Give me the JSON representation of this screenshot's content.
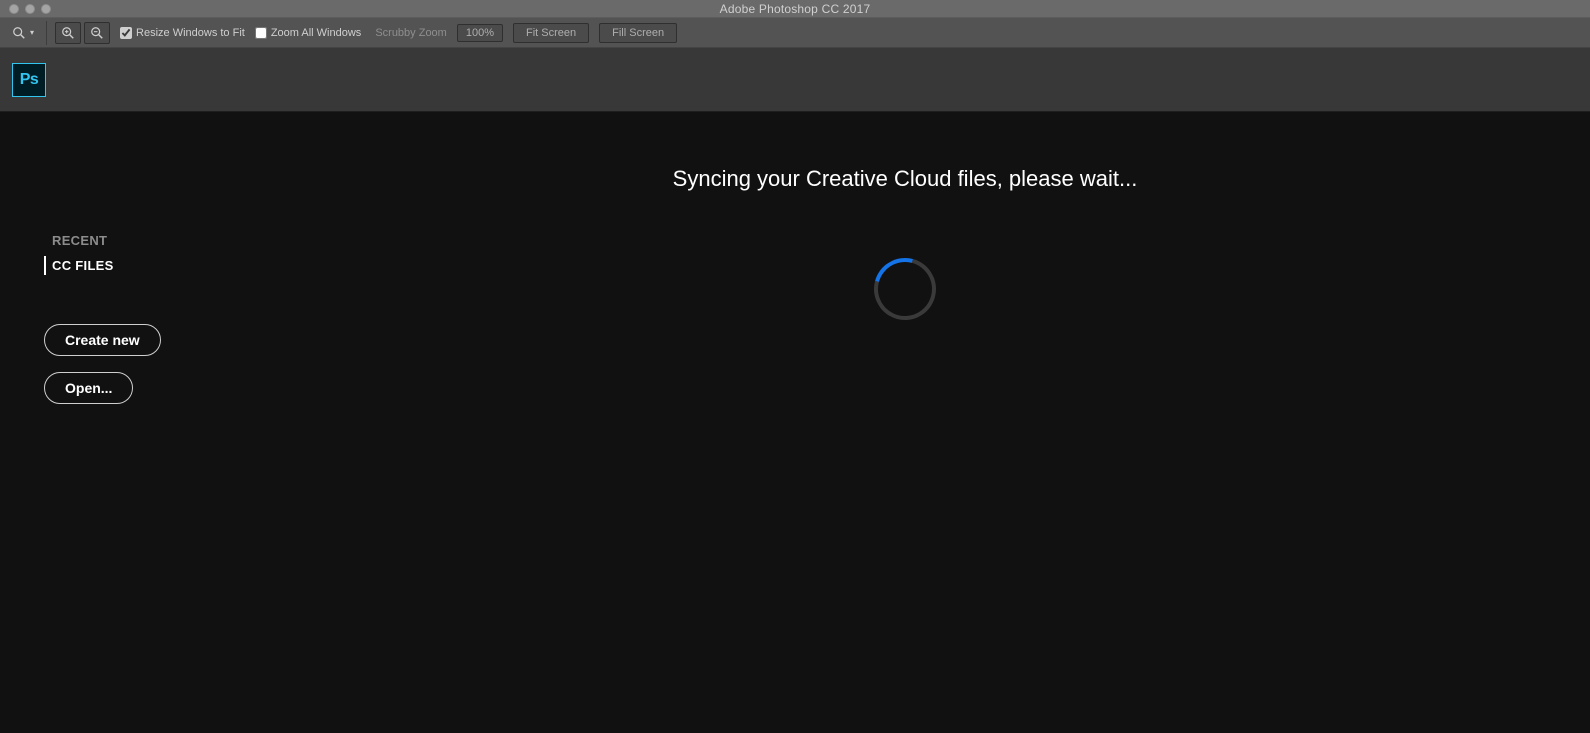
{
  "window": {
    "title": "Adobe Photoshop CC 2017"
  },
  "toolbar": {
    "resize_label": "Resize Windows to Fit",
    "resize_checked": true,
    "zoomall_label": "Zoom All Windows",
    "zoomall_checked": false,
    "scrubby_label": "Scrubby Zoom",
    "zoom_pct": "100%",
    "fit_label": "Fit Screen",
    "fill_label": "Fill Screen"
  },
  "logo": {
    "text": "Ps"
  },
  "sidebar": {
    "items": [
      {
        "label": "RECENT",
        "active": false
      },
      {
        "label": "CC FILES",
        "active": true
      }
    ]
  },
  "actions": {
    "create_label": "Create new",
    "open_label": "Open..."
  },
  "main": {
    "sync_msg": "Syncing your Creative Cloud files, please wait..."
  }
}
